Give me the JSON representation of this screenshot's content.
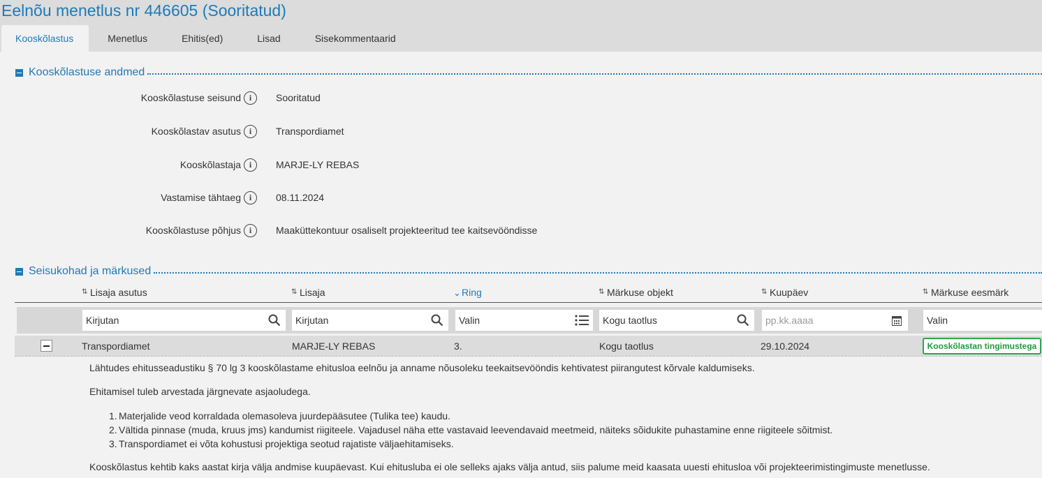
{
  "header": {
    "title": "Eelnõu menetlus nr 446605 (Sooritatud)"
  },
  "tabs": [
    {
      "label": "Kooskõlastus",
      "active": true
    },
    {
      "label": "Menetlus"
    },
    {
      "label": "Ehitis(ed)"
    },
    {
      "label": "Lisad"
    },
    {
      "label": "Sisekommentaarid"
    }
  ],
  "section1": {
    "title": "Kooskõlastuse andmed",
    "fields": [
      {
        "label": "Kooskõlastuse seisund",
        "value": "Sooritatud"
      },
      {
        "label": "Kooskõlastav asutus",
        "value": "Transpordiamet"
      },
      {
        "label": "Kooskõlastaja",
        "value": "MARJE-LY REBAS"
      },
      {
        "label": "Vastamise tähtaeg",
        "value": "08.11.2024"
      },
      {
        "label": "Kooskõlastuse põhjus",
        "value": "Maaküttekontuur osaliselt projekteeritud tee kaitsevööndisse"
      }
    ],
    "info_glyph": "i"
  },
  "section2": {
    "title": "Seisukohad ja märkused",
    "columns": [
      {
        "label": "Lisaja asutus"
      },
      {
        "label": "Lisaja"
      },
      {
        "label": "Ring"
      },
      {
        "label": "Märkuse objekt"
      },
      {
        "label": "Kuupäev"
      },
      {
        "label": "Märkuse eesmärk"
      }
    ],
    "filters": {
      "lisaja_asutus": "Kirjutan",
      "lisaja": "Kirjutan",
      "ring": "Valin",
      "objekt": "Kogu taotlus",
      "kuupaev_placeholder": "pp.kk.aaaa",
      "eesmark": "Valin"
    },
    "row": {
      "asutus": "Transpordiamet",
      "lisaja": "MARJE-LY REBAS",
      "ring": "3.",
      "objekt": "Kogu taotlus",
      "kuupaev": "29.10.2024",
      "eesmark": "Kooskõlastan tingimustega",
      "status_color": "#2aa84a"
    },
    "details": {
      "p1": "Lähtudes ehitusseadustiku § 70 lg 3 kooskõlastame ehitusloa eelnõu ja anname nõusoleku teekaitsevööndis kehtivatest piirangutest kõrvale kaldumiseks.",
      "p2": "Ehitamisel tuleb arvestada järgnevate asjaoludega.",
      "items": [
        {
          "num": "1.",
          "text": "Materjalide veod korraldada olemasoleva juurdepääsutee (Tulika tee) kaudu."
        },
        {
          "num": "2.",
          "text": "Vältida pinnase (muda, kruus jms) kandumist riigiteele. Vajadusel näha ette vastavaid leevendavaid meetmeid, näiteks sõidukite puhastamine enne riigiteele sõitmist."
        },
        {
          "num": "3.",
          "text": "Transpordiamet ei võta kohustusi projektiga seotud rajatiste väljaehitamiseks."
        }
      ],
      "p3": "Kooskõlastus kehtib kaks aastat kirja välja andmise kuupäevast. Kui ehitusluba ei ole selleks ajaks välja antud, siis palume meid kaasata uuesti ehitusloa või projekteerimistingimuste menetlusse."
    }
  },
  "colors": {
    "accent": "#1f7ab8",
    "success": "#2aa84a"
  }
}
